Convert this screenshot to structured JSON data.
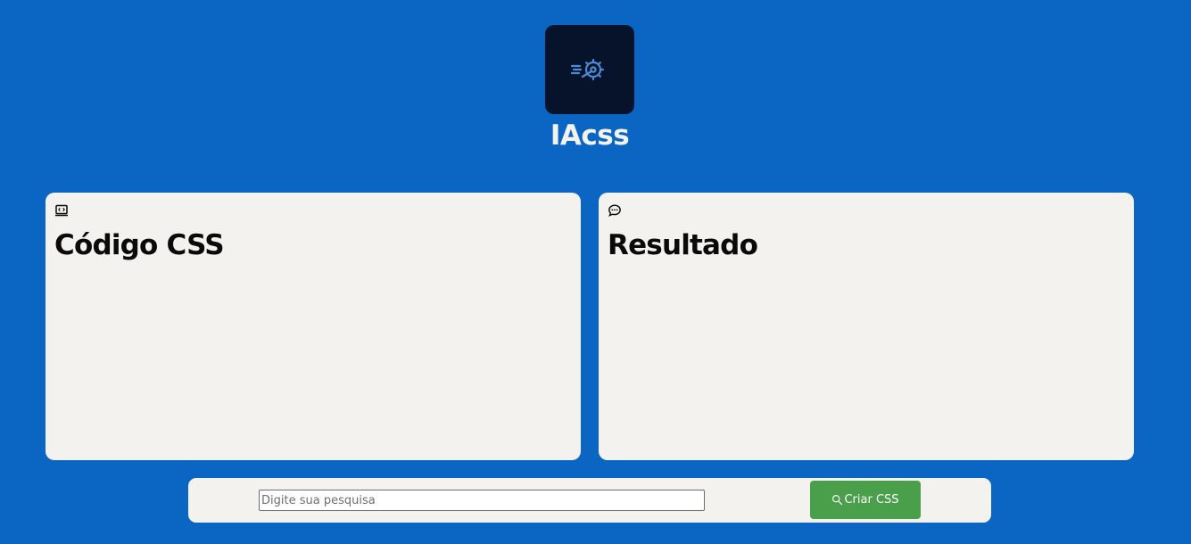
{
  "header": {
    "logo_icon": "gear-speed-logo-icon",
    "title": "IAcss"
  },
  "panels": [
    {
      "icon": "code-window-icon",
      "title": "Código CSS"
    },
    {
      "icon": "chat-bubble-icon",
      "title": "Resultado"
    }
  ],
  "search": {
    "placeholder": "Digite sua pesquisa",
    "value": "",
    "button_icon": "search-icon",
    "button_label": "Criar CSS"
  },
  "colors": {
    "background": "#0b66c3",
    "logo_background": "#07132a",
    "panel_background": "#f3f2ef",
    "button": "#4a9f4a",
    "logo_accent": "#4a8ad6"
  }
}
